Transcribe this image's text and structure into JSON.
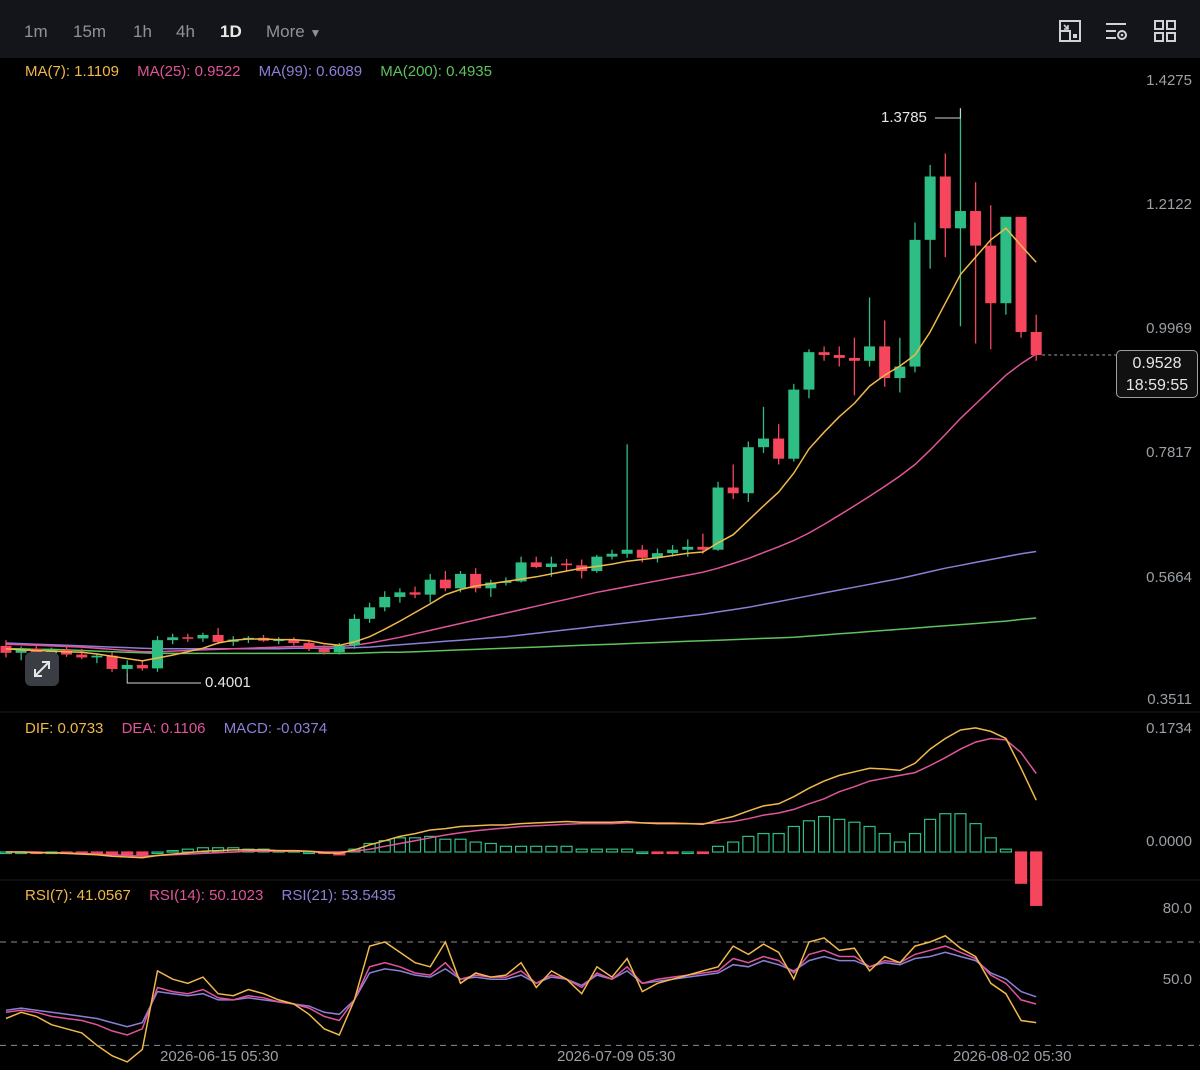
{
  "toolbar": {
    "intervals": [
      "1m",
      "15m",
      "1h",
      "4h",
      "1D"
    ],
    "active_interval": "1D",
    "more_label": "More",
    "icons": [
      "chart-type-icon",
      "indicator-settings-icon",
      "grid-layout-icon"
    ]
  },
  "ma_legend": [
    {
      "label": "MA(7): 1.1109",
      "color": "#f0b94a"
    },
    {
      "label": "MA(25): 0.9522",
      "color": "#e0559a"
    },
    {
      "label": "MA(99): 0.6089",
      "color": "#8b7fd6"
    },
    {
      "label": "MA(200): 0.4935",
      "color": "#5fc25f"
    }
  ],
  "macd_legend": [
    {
      "label": "DIF: 0.0733",
      "color": "#f0b94a"
    },
    {
      "label": "DEA: 0.1106",
      "color": "#e0559a"
    },
    {
      "label": "MACD: -0.0374",
      "color": "#8b7fd6"
    }
  ],
  "rsi_legend": [
    {
      "label": "RSI(7): 41.0567",
      "color": "#f0b94a"
    },
    {
      "label": "RSI(14): 50.1023",
      "color": "#e0559a"
    },
    {
      "label": "RSI(21): 53.5435",
      "color": "#8b7fd6"
    }
  ],
  "price_axis": [
    "1.4275",
    "1.2122",
    "0.9969",
    "0.7817",
    "0.5664",
    "0.3511"
  ],
  "macd_axis": [
    "0.1734",
    "0.0000"
  ],
  "rsi_axis": [
    "80.0",
    "50.0"
  ],
  "current_price": {
    "price": "0.9528",
    "countdown": "18:59:55"
  },
  "high_label": "1.3785",
  "low_label": "0.4001",
  "x_labels": [
    "2026-06-15 05:30",
    "2026-07-09 05:30",
    "2026-08-02 05:30"
  ],
  "colors": {
    "up": "#2ebd85",
    "down": "#f6465d",
    "ma7": "#f0b94a",
    "ma25": "#e0559a",
    "ma99": "#8b7fd6",
    "ma200": "#5fc25f"
  },
  "chart_data": {
    "type": "candlestick",
    "interval": "1D",
    "candles": [
      {
        "o": 0.445,
        "h": 0.455,
        "l": 0.425,
        "c": 0.433
      },
      {
        "o": 0.433,
        "h": 0.444,
        "l": 0.42,
        "c": 0.44
      },
      {
        "o": 0.44,
        "h": 0.448,
        "l": 0.428,
        "c": 0.432
      },
      {
        "o": 0.432,
        "h": 0.442,
        "l": 0.425,
        "c": 0.438
      },
      {
        "o": 0.438,
        "h": 0.446,
        "l": 0.426,
        "c": 0.43
      },
      {
        "o": 0.43,
        "h": 0.44,
        "l": 0.422,
        "c": 0.425
      },
      {
        "o": 0.425,
        "h": 0.432,
        "l": 0.415,
        "c": 0.428
      },
      {
        "o": 0.428,
        "h": 0.434,
        "l": 0.4,
        "c": 0.405
      },
      {
        "o": 0.405,
        "h": 0.42,
        "l": 0.398,
        "c": 0.412
      },
      {
        "o": 0.412,
        "h": 0.418,
        "l": 0.402,
        "c": 0.406
      },
      {
        "o": 0.406,
        "h": 0.462,
        "l": 0.4,
        "c": 0.455
      },
      {
        "o": 0.455,
        "h": 0.466,
        "l": 0.448,
        "c": 0.46
      },
      {
        "o": 0.46,
        "h": 0.466,
        "l": 0.452,
        "c": 0.458
      },
      {
        "o": 0.458,
        "h": 0.468,
        "l": 0.452,
        "c": 0.464
      },
      {
        "o": 0.464,
        "h": 0.476,
        "l": 0.448,
        "c": 0.452
      },
      {
        "o": 0.452,
        "h": 0.462,
        "l": 0.445,
        "c": 0.456
      },
      {
        "o": 0.456,
        "h": 0.462,
        "l": 0.45,
        "c": 0.459
      },
      {
        "o": 0.459,
        "h": 0.464,
        "l": 0.452,
        "c": 0.454
      },
      {
        "o": 0.454,
        "h": 0.46,
        "l": 0.448,
        "c": 0.456
      },
      {
        "o": 0.456,
        "h": 0.46,
        "l": 0.446,
        "c": 0.45
      },
      {
        "o": 0.45,
        "h": 0.456,
        "l": 0.436,
        "c": 0.44
      },
      {
        "o": 0.44,
        "h": 0.446,
        "l": 0.43,
        "c": 0.434
      },
      {
        "o": 0.434,
        "h": 0.45,
        "l": 0.43,
        "c": 0.446
      },
      {
        "o": 0.446,
        "h": 0.5,
        "l": 0.44,
        "c": 0.492
      },
      {
        "o": 0.492,
        "h": 0.52,
        "l": 0.485,
        "c": 0.512
      },
      {
        "o": 0.512,
        "h": 0.54,
        "l": 0.505,
        "c": 0.53
      },
      {
        "o": 0.53,
        "h": 0.545,
        "l": 0.52,
        "c": 0.538
      },
      {
        "o": 0.538,
        "h": 0.548,
        "l": 0.528,
        "c": 0.534
      },
      {
        "o": 0.534,
        "h": 0.57,
        "l": 0.52,
        "c": 0.56
      },
      {
        "o": 0.56,
        "h": 0.575,
        "l": 0.54,
        "c": 0.545
      },
      {
        "o": 0.545,
        "h": 0.575,
        "l": 0.538,
        "c": 0.57
      },
      {
        "o": 0.57,
        "h": 0.58,
        "l": 0.538,
        "c": 0.545
      },
      {
        "o": 0.545,
        "h": 0.56,
        "l": 0.53,
        "c": 0.555
      },
      {
        "o": 0.555,
        "h": 0.564,
        "l": 0.55,
        "c": 0.557
      },
      {
        "o": 0.557,
        "h": 0.6,
        "l": 0.555,
        "c": 0.59
      },
      {
        "o": 0.59,
        "h": 0.6,
        "l": 0.58,
        "c": 0.582
      },
      {
        "o": 0.582,
        "h": 0.6,
        "l": 0.565,
        "c": 0.588
      },
      {
        "o": 0.588,
        "h": 0.596,
        "l": 0.575,
        "c": 0.585
      },
      {
        "o": 0.585,
        "h": 0.595,
        "l": 0.562,
        "c": 0.575
      },
      {
        "o": 0.575,
        "h": 0.603,
        "l": 0.572,
        "c": 0.6
      },
      {
        "o": 0.6,
        "h": 0.612,
        "l": 0.595,
        "c": 0.605
      },
      {
        "o": 0.605,
        "h": 0.795,
        "l": 0.598,
        "c": 0.612
      },
      {
        "o": 0.612,
        "h": 0.62,
        "l": 0.59,
        "c": 0.598
      },
      {
        "o": 0.598,
        "h": 0.614,
        "l": 0.59,
        "c": 0.606
      },
      {
        "o": 0.606,
        "h": 0.62,
        "l": 0.6,
        "c": 0.612
      },
      {
        "o": 0.612,
        "h": 0.63,
        "l": 0.6,
        "c": 0.617
      },
      {
        "o": 0.617,
        "h": 0.64,
        "l": 0.605,
        "c": 0.612
      },
      {
        "o": 0.612,
        "h": 0.73,
        "l": 0.61,
        "c": 0.72
      },
      {
        "o": 0.72,
        "h": 0.76,
        "l": 0.7,
        "c": 0.71
      },
      {
        "o": 0.71,
        "h": 0.8,
        "l": 0.695,
        "c": 0.79
      },
      {
        "o": 0.79,
        "h": 0.86,
        "l": 0.78,
        "c": 0.805
      },
      {
        "o": 0.805,
        "h": 0.83,
        "l": 0.76,
        "c": 0.77
      },
      {
        "o": 0.77,
        "h": 0.9,
        "l": 0.765,
        "c": 0.89
      },
      {
        "o": 0.89,
        "h": 0.96,
        "l": 0.875,
        "c": 0.955
      },
      {
        "o": 0.955,
        "h": 0.965,
        "l": 0.94,
        "c": 0.95
      },
      {
        "o": 0.95,
        "h": 0.965,
        "l": 0.93,
        "c": 0.945
      },
      {
        "o": 0.945,
        "h": 0.98,
        "l": 0.88,
        "c": 0.94
      },
      {
        "o": 0.94,
        "h": 1.05,
        "l": 0.93,
        "c": 0.965
      },
      {
        "o": 0.965,
        "h": 1.01,
        "l": 0.895,
        "c": 0.91
      },
      {
        "o": 0.91,
        "h": 0.98,
        "l": 0.885,
        "c": 0.93
      },
      {
        "o": 0.93,
        "h": 1.18,
        "l": 0.92,
        "c": 1.15
      },
      {
        "o": 1.15,
        "h": 1.28,
        "l": 1.1,
        "c": 1.26
      },
      {
        "o": 1.26,
        "h": 1.3,
        "l": 1.12,
        "c": 1.17
      },
      {
        "o": 1.17,
        "h": 1.3785,
        "l": 1.0,
        "c": 1.2
      },
      {
        "o": 1.2,
        "h": 1.25,
        "l": 0.97,
        "c": 1.14
      },
      {
        "o": 1.14,
        "h": 1.21,
        "l": 0.96,
        "c": 1.04
      },
      {
        "o": 1.04,
        "h": 1.14,
        "l": 1.02,
        "c": 1.19
      },
      {
        "o": 1.19,
        "h": 1.19,
        "l": 0.98,
        "c": 0.99
      },
      {
        "o": 0.99,
        "h": 1.02,
        "l": 0.94,
        "c": 0.95
      }
    ],
    "ma7": [
      0.44,
      0.438,
      0.437,
      0.436,
      0.435,
      0.434,
      0.431,
      0.427,
      0.423,
      0.419,
      0.424,
      0.429,
      0.435,
      0.441,
      0.45,
      0.455,
      0.457,
      0.457,
      0.456,
      0.456,
      0.454,
      0.449,
      0.446,
      0.452,
      0.461,
      0.474,
      0.488,
      0.503,
      0.518,
      0.534,
      0.543,
      0.549,
      0.553,
      0.557,
      0.561,
      0.565,
      0.57,
      0.575,
      0.58,
      0.583,
      0.587,
      0.592,
      0.595,
      0.598,
      0.602,
      0.606,
      0.608,
      0.624,
      0.638,
      0.663,
      0.688,
      0.712,
      0.745,
      0.787,
      0.816,
      0.843,
      0.866,
      0.896,
      0.915,
      0.931,
      0.95,
      0.99,
      1.04,
      1.09,
      1.12,
      1.15,
      1.17,
      1.14,
      1.111
    ],
    "ma25": [
      0.448,
      0.447,
      0.446,
      0.445,
      0.444,
      0.443,
      0.441,
      0.439,
      0.437,
      0.435,
      0.435,
      0.436,
      0.437,
      0.438,
      0.439,
      0.44,
      0.441,
      0.442,
      0.443,
      0.444,
      0.444,
      0.444,
      0.444,
      0.446,
      0.45,
      0.455,
      0.46,
      0.466,
      0.472,
      0.478,
      0.484,
      0.49,
      0.496,
      0.502,
      0.508,
      0.514,
      0.52,
      0.526,
      0.532,
      0.538,
      0.543,
      0.548,
      0.553,
      0.558,
      0.563,
      0.568,
      0.573,
      0.58,
      0.588,
      0.597,
      0.607,
      0.617,
      0.628,
      0.641,
      0.656,
      0.672,
      0.688,
      0.705,
      0.722,
      0.74,
      0.76,
      0.785,
      0.812,
      0.84,
      0.865,
      0.89,
      0.915,
      0.935,
      0.952
    ],
    "ma99": [
      0.45,
      0.449,
      0.448,
      0.447,
      0.446,
      0.445,
      0.444,
      0.443,
      0.442,
      0.441,
      0.44,
      0.44,
      0.44,
      0.44,
      0.44,
      0.44,
      0.44,
      0.44,
      0.44,
      0.441,
      0.441,
      0.441,
      0.441,
      0.442,
      0.443,
      0.445,
      0.447,
      0.449,
      0.451,
      0.453,
      0.455,
      0.457,
      0.459,
      0.461,
      0.464,
      0.467,
      0.47,
      0.473,
      0.476,
      0.479,
      0.482,
      0.485,
      0.488,
      0.491,
      0.494,
      0.497,
      0.5,
      0.504,
      0.508,
      0.512,
      0.517,
      0.522,
      0.527,
      0.532,
      0.537,
      0.542,
      0.547,
      0.552,
      0.557,
      0.562,
      0.568,
      0.574,
      0.58,
      0.585,
      0.59,
      0.595,
      0.6,
      0.605,
      0.609
    ],
    "ma200": [
      0.44,
      0.44,
      0.439,
      0.439,
      0.438,
      0.437,
      0.436,
      0.435,
      0.434,
      0.433,
      0.432,
      0.432,
      0.432,
      0.432,
      0.432,
      0.432,
      0.432,
      0.432,
      0.432,
      0.432,
      0.432,
      0.432,
      0.432,
      0.432,
      0.433,
      0.434,
      0.434,
      0.435,
      0.436,
      0.437,
      0.438,
      0.439,
      0.44,
      0.441,
      0.442,
      0.443,
      0.444,
      0.445,
      0.446,
      0.447,
      0.448,
      0.449,
      0.45,
      0.451,
      0.452,
      0.453,
      0.454,
      0.455,
      0.456,
      0.457,
      0.458,
      0.459,
      0.46,
      0.462,
      0.464,
      0.466,
      0.468,
      0.47,
      0.472,
      0.474,
      0.476,
      0.478,
      0.48,
      0.482,
      0.484,
      0.486,
      0.488,
      0.491,
      0.4935
    ],
    "macd_dif": [
      0.0,
      0.0,
      -0.001,
      -0.001,
      -0.002,
      -0.003,
      -0.004,
      -0.006,
      -0.007,
      -0.008,
      -0.005,
      -0.003,
      -0.001,
      0.001,
      0.002,
      0.003,
      0.003,
      0.003,
      0.002,
      0.002,
      0.001,
      -0.001,
      -0.002,
      0.003,
      0.01,
      0.016,
      0.022,
      0.026,
      0.031,
      0.033,
      0.036,
      0.037,
      0.038,
      0.038,
      0.04,
      0.041,
      0.042,
      0.043,
      0.042,
      0.042,
      0.042,
      0.043,
      0.041,
      0.04,
      0.04,
      0.04,
      0.039,
      0.045,
      0.05,
      0.058,
      0.065,
      0.068,
      0.078,
      0.09,
      0.1,
      0.108,
      0.113,
      0.118,
      0.117,
      0.115,
      0.125,
      0.145,
      0.16,
      0.172,
      0.175,
      0.17,
      0.16,
      0.118,
      0.073
    ],
    "macd_dea": [
      0.0,
      0.0,
      0.0,
      -0.001,
      -0.001,
      -0.002,
      -0.003,
      -0.004,
      -0.005,
      -0.006,
      -0.005,
      -0.004,
      -0.003,
      -0.002,
      -0.001,
      0.0,
      0.001,
      0.001,
      0.001,
      0.001,
      0.001,
      0.0,
      0.0,
      0.001,
      0.004,
      0.008,
      0.012,
      0.016,
      0.02,
      0.024,
      0.027,
      0.03,
      0.032,
      0.034,
      0.036,
      0.037,
      0.038,
      0.039,
      0.04,
      0.04,
      0.04,
      0.041,
      0.041,
      0.041,
      0.041,
      0.04,
      0.04,
      0.041,
      0.043,
      0.047,
      0.052,
      0.055,
      0.06,
      0.068,
      0.075,
      0.085,
      0.092,
      0.1,
      0.104,
      0.108,
      0.112,
      0.122,
      0.133,
      0.145,
      0.155,
      0.16,
      0.158,
      0.14,
      0.1106
    ],
    "rsi7": [
      43,
      46,
      44,
      40,
      38,
      36,
      30,
      25,
      22,
      28,
      66,
      62,
      60,
      63,
      55,
      54,
      57,
      55,
      52,
      50,
      45,
      38,
      35,
      52,
      78,
      80,
      75,
      70,
      68,
      80,
      60,
      65,
      63,
      64,
      70,
      58,
      66,
      62,
      55,
      68,
      63,
      72,
      56,
      60,
      62,
      64,
      66,
      68,
      78,
      74,
      79,
      75,
      62,
      80,
      82,
      76,
      77,
      66,
      73,
      70,
      78,
      80,
      83,
      77,
      73,
      60,
      55,
      42,
      41
    ],
    "rsi14": [
      46,
      47,
      46,
      44,
      43,
      42,
      40,
      37,
      35,
      38,
      58,
      56,
      55,
      57,
      53,
      52,
      54,
      53,
      51,
      50,
      48,
      44,
      42,
      52,
      68,
      70,
      68,
      65,
      64,
      70,
      62,
      64,
      63,
      63,
      66,
      60,
      64,
      62,
      58,
      65,
      62,
      68,
      60,
      62,
      63,
      64,
      65,
      66,
      72,
      70,
      73,
      71,
      65,
      74,
      76,
      73,
      73,
      68,
      71,
      70,
      74,
      76,
      78,
      75,
      72,
      64,
      60,
      52,
      50
    ],
    "rsi21": [
      47,
      48,
      47,
      46,
      45,
      44,
      43,
      41,
      39,
      41,
      56,
      55,
      54,
      55,
      52,
      52,
      53,
      52,
      51,
      50,
      49,
      46,
      45,
      52,
      65,
      67,
      66,
      64,
      63,
      67,
      62,
      63,
      62,
      62,
      64,
      60,
      63,
      62,
      59,
      64,
      62,
      66,
      60,
      61,
      62,
      63,
      64,
      65,
      69,
      68,
      71,
      69,
      66,
      71,
      73,
      71,
      71,
      68,
      70,
      69,
      72,
      73,
      75,
      73,
      71,
      65,
      62,
      56,
      53.5
    ]
  }
}
